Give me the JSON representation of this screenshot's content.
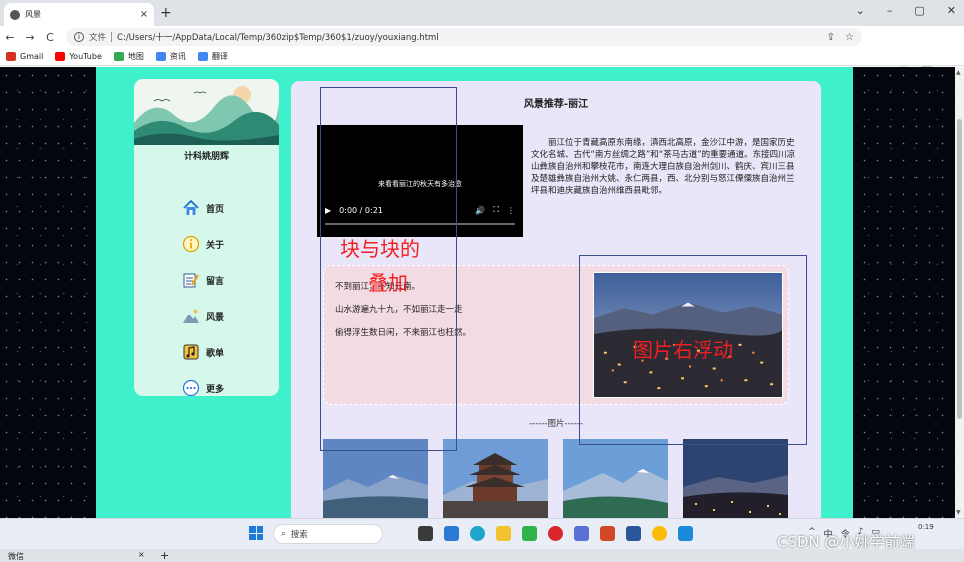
{
  "browser": {
    "tab_title": "风景",
    "tab_close": "×",
    "new_tab": "+",
    "window_controls": [
      "⌄",
      "–",
      "▢",
      "✕"
    ],
    "nav": {
      "back": "←",
      "forward": "→",
      "reload": "C"
    },
    "url_scheme": "文件",
    "url": "C:/Users/十一/AppData/Local/Temp/360zip$Temp/360$1/zuoy/youxiang.html",
    "bookmarks": [
      {
        "label": "Gmail",
        "color": "#d93025"
      },
      {
        "label": "YouTube",
        "color": "#ff0000"
      },
      {
        "label": "地图",
        "color": "#34a853"
      },
      {
        "label": "资讯",
        "color": "#4285f4"
      },
      {
        "label": "翻译",
        "color": "#4285f4"
      }
    ]
  },
  "sidebar": {
    "owner": "计科姚朋辉",
    "items": [
      {
        "label": "首页",
        "icon": "home-icon"
      },
      {
        "label": "关于",
        "icon": "info-icon"
      },
      {
        "label": "留言",
        "icon": "message-icon"
      },
      {
        "label": "风景",
        "icon": "scenery-icon"
      },
      {
        "label": "歌单",
        "icon": "music-icon"
      },
      {
        "label": "更多",
        "icon": "more-icon"
      }
    ]
  },
  "main": {
    "title": "风景推荐-丽江",
    "video": {
      "caption": "来看看丽江的秋天有多治愈",
      "time": "0:00 / 0:21",
      "play": "▶",
      "volume": "🔊",
      "fullscreen": "⛶",
      "menu": "⋮"
    },
    "intro": "丽江位于青藏高原东南缘，滇西北高原，金沙江中游，是国家历史文化名城、古代“南方丝绸之路”和“茶马古道”的重要通道。东接四川凉山彝族自治州和攀枝花市，南连大理白族自治州剑川、鹤庆、宾川三县及楚雄彝族自治州大姚、永仁两县，西、北分别与怒江傈僳族自治州兰坪县和迪庆藏族自治州维西县毗邻。",
    "poem": [
      "不到丽江，不知云南。",
      "山水游遍九十九，不如丽江走一走",
      "偷得浮生数日闲，不来丽江也枉然。"
    ],
    "gallery_label": "------图片------"
  },
  "annotations": {
    "overlap_line1": "块与块的",
    "overlap_line2": "叠加",
    "float_right": "图片右浮动"
  },
  "taskbar": {
    "search_placeholder": "搜索",
    "tray": [
      "^",
      "中",
      "令",
      "♪",
      "▭"
    ],
    "time": "0:19",
    "watermark": "CSDN @小姚学前端"
  },
  "second_window": {
    "tab_title": "微信",
    "tab_close": "×",
    "new_tab": "+"
  }
}
